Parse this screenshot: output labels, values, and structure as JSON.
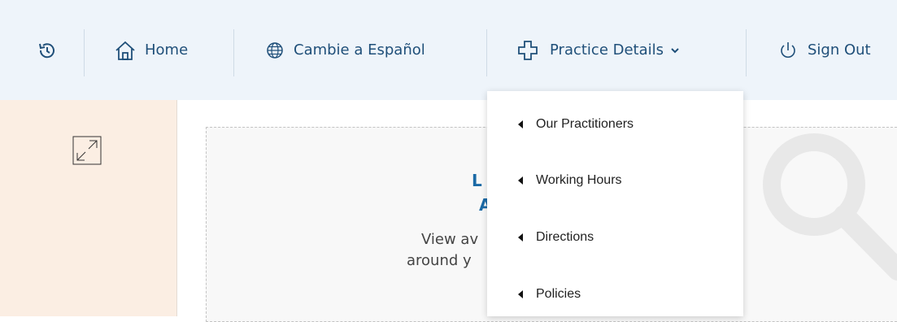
{
  "nav": {
    "home_label": "Home",
    "spanish_label": "Cambie a Español",
    "practice_label": "Practice Details",
    "signout_label": "Sign Out"
  },
  "dropdown": {
    "items": [
      {
        "label": "Our Practitioners"
      },
      {
        "label": "Working Hours"
      },
      {
        "label": "Directions"
      },
      {
        "label": "Policies"
      }
    ]
  },
  "card": {
    "title_fragment_1": "L",
    "title_fragment_2": "A",
    "text_fragment_1": "View av",
    "text_fragment_2": "around y"
  },
  "icons": {
    "history": "history-icon",
    "home": "home-icon",
    "globe": "globe-icon",
    "cross": "medical-cross-icon",
    "chevron": "chevron-down-icon",
    "power": "power-icon",
    "expand": "expand-icon",
    "magnifier": "magnifier-icon"
  },
  "colors": {
    "topbar_bg": "#eef4fa",
    "nav_text": "#1f4f79",
    "left_pane_bg": "#fbeee3",
    "title_blue": "#1b6aa6"
  }
}
